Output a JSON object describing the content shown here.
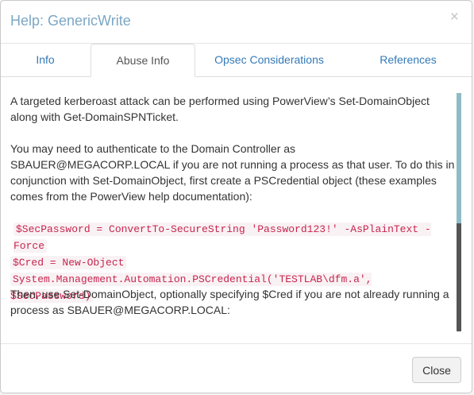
{
  "dialog": {
    "title": "Help: GenericWrite",
    "close_icon": "×"
  },
  "tabs": [
    {
      "label": "Info",
      "active": false
    },
    {
      "label": "Abuse Info",
      "active": true
    },
    {
      "label": "Opsec Considerations",
      "active": false
    },
    {
      "label": "References",
      "active": false
    }
  ],
  "content": {
    "paragraph1": "A targeted kerberoast attack can be performed using PowerView’s Set-DomainObject along with Get-DomainSPNTicket.",
    "paragraph2": "You may need to authenticate to the Domain Controller as SBAUER@MEGACORP.LOCAL if you are not running a process as that user. To do this in conjunction with Set-DomainObject, first create a PSCredential object (these examples comes from the PowerView help documentation):",
    "code_lines": [
      "$SecPassword = ConvertTo-SecureString 'Password123!' -AsPlainText -Force",
      "$Cred = New-Object",
      "System.Management.Automation.PSCredential('TESTLAB\\dfm.a', $SecPassword)"
    ],
    "paragraph3": "Then, use Set-DomainObject, optionally specifying $Cred if you are not already running a process as SBAUER@MEGACORP.LOCAL:"
  },
  "footer": {
    "close_label": "Close"
  },
  "colors": {
    "title": "#7ba7c4",
    "link": "#337ab7",
    "code_text": "#c7254e",
    "code_bg": "#f9f2f4",
    "scroll_thumb": "#8fbcc4"
  }
}
